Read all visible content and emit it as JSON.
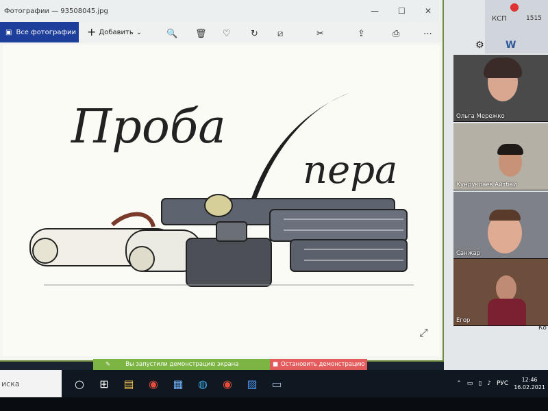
{
  "window": {
    "title": "Фотографии — 93508045.jpg",
    "controls": [
      "—",
      "☐",
      "✕"
    ]
  },
  "toolbar": {
    "all_photos_label": "Все фотографии",
    "add_label": "Добавить",
    "add_suffix": "⌄"
  },
  "image": {
    "title_line1": "Проба",
    "title_line2": "пера"
  },
  "participants": [
    {
      "name": "Ольга Мережко"
    },
    {
      "name": "Кундуклаев Айтбай"
    },
    {
      "name": "Санжар"
    },
    {
      "name": "Егор"
    }
  ],
  "right_panel": {
    "app_label_1": "КСП",
    "app_label_2": "1515",
    "cut_label": "Ко"
  },
  "share_bar": {
    "message": "Вы запустили демонстрацию экрана",
    "stop_label": "Остановить демонстрацию"
  },
  "taskbar": {
    "search_text": "иска",
    "lang": "РУС",
    "time": "12:46",
    "date": "16.02.2021"
  },
  "colors": {
    "accent": "#1d3f9b",
    "share_green": "#7db544",
    "stop_red": "#e45b5b"
  }
}
